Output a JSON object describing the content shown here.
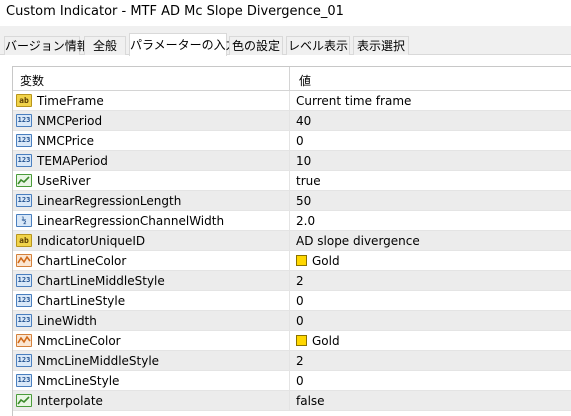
{
  "window": {
    "title": "Custom Indicator - MTF AD Mc Slope Divergence_01"
  },
  "tabs": [
    {
      "label": "バージョン情報"
    },
    {
      "label": "全般"
    },
    {
      "label": "パラメーターの入力",
      "active": true
    },
    {
      "label": "色の設定"
    },
    {
      "label": "レベル表示"
    },
    {
      "label": "表示選択"
    }
  ],
  "grid": {
    "headers": {
      "variable": "変数",
      "value": "値"
    },
    "rows": [
      {
        "icon": "string-icon",
        "name": "TimeFrame",
        "value": "Current time frame"
      },
      {
        "icon": "integer-icon",
        "name": "NMCPeriod",
        "value": "40"
      },
      {
        "icon": "integer-icon",
        "name": "NMCPrice",
        "value": "0"
      },
      {
        "icon": "integer-icon",
        "name": "TEMAPeriod",
        "value": "10"
      },
      {
        "icon": "boolean-icon",
        "name": "UseRiver",
        "value": "true"
      },
      {
        "icon": "integer-icon",
        "name": "LinearRegressionLength",
        "value": "50"
      },
      {
        "icon": "double-icon",
        "name": "LinearRegressionChannelWidth",
        "value": "2.0"
      },
      {
        "icon": "string-icon",
        "name": "IndicatorUniqueID",
        "value": "AD slope divergence"
      },
      {
        "icon": "color-icon",
        "name": "ChartLineColor",
        "value": "Gold",
        "swatch": "#FFD700"
      },
      {
        "icon": "integer-icon",
        "name": "ChartLineMiddleStyle",
        "value": "2"
      },
      {
        "icon": "integer-icon",
        "name": "ChartLineStyle",
        "value": "0"
      },
      {
        "icon": "integer-icon",
        "name": "LineWidth",
        "value": "0"
      },
      {
        "icon": "color-icon",
        "name": "NmcLineColor",
        "value": "Gold",
        "swatch": "#FFD700"
      },
      {
        "icon": "integer-icon",
        "name": "NmcLineMiddleStyle",
        "value": "2"
      },
      {
        "icon": "integer-icon",
        "name": "NmcLineStyle",
        "value": "0"
      },
      {
        "icon": "boolean-icon",
        "name": "Interpolate",
        "value": "false"
      }
    ]
  }
}
